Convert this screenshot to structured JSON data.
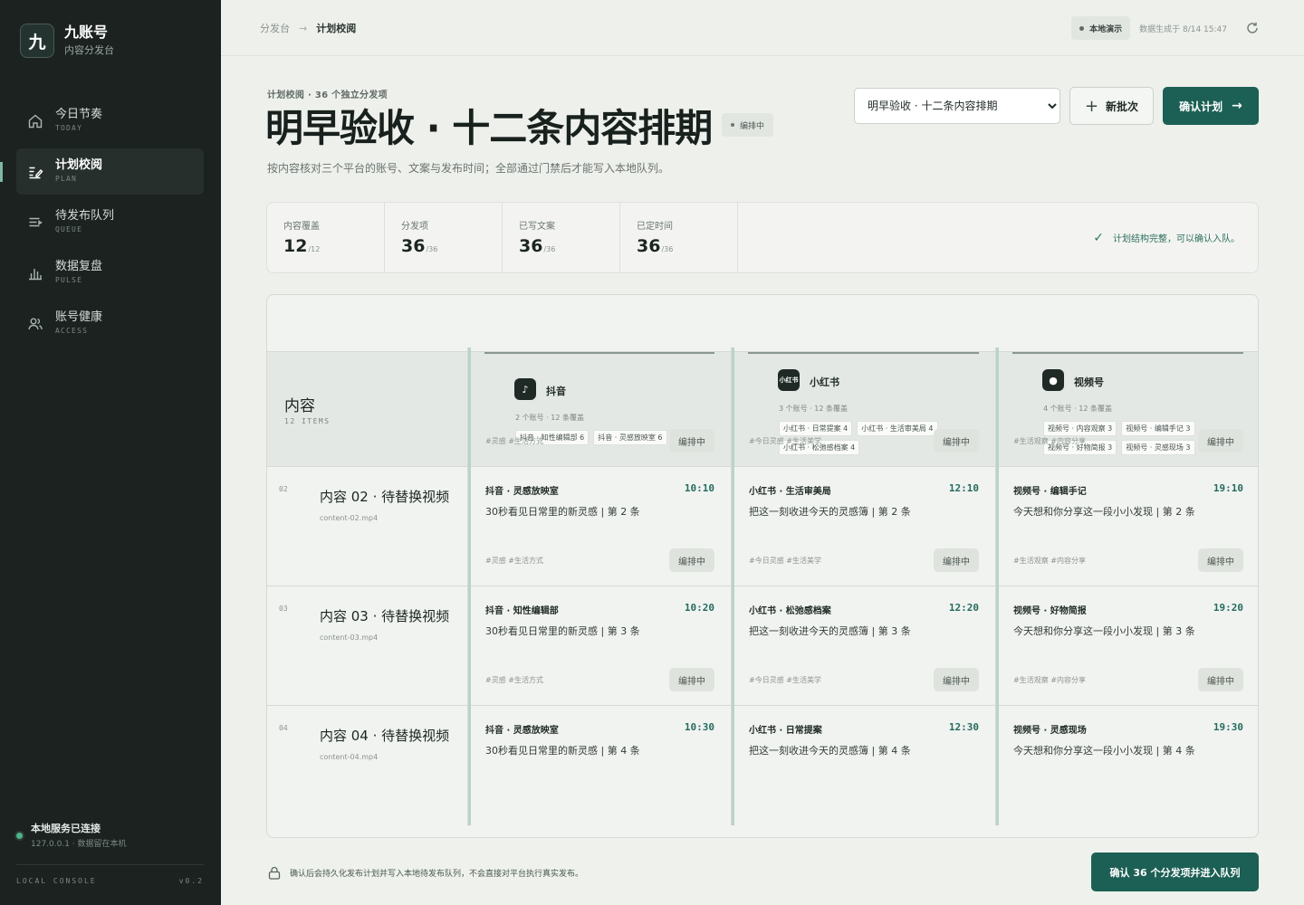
{
  "brand": {
    "logo_char": "九",
    "name": "九账号",
    "subtitle": "内容分发台"
  },
  "nav": {
    "items": [
      {
        "label": "今日节奏",
        "en": "TODAY",
        "icon": "home-icon",
        "active": false
      },
      {
        "label": "计划校阅",
        "en": "PLAN",
        "icon": "edit-list-icon",
        "active": true
      },
      {
        "label": "待发布队列",
        "en": "QUEUE",
        "icon": "queue-icon",
        "active": false
      },
      {
        "label": "数据复盘",
        "en": "PULSE",
        "icon": "bar-chart-icon",
        "active": false
      },
      {
        "label": "账号健康",
        "en": "ACCESS",
        "icon": "users-icon",
        "active": false
      }
    ]
  },
  "service": {
    "title": "本地服务已连接",
    "subtitle": "127.0.0.1 · 数据留在本机"
  },
  "footer": {
    "left": "LOCAL CONSOLE",
    "right": "v0.2"
  },
  "breadcrumb": {
    "root": "分发台",
    "current": "计划校阅"
  },
  "topbar": {
    "demo_label": "本地演示",
    "generated": "数据生成于 8/14 15:47"
  },
  "header": {
    "eyebrow": "计划校阅 · 36 个独立分发项",
    "title": "明早验收 · 十二条内容排期",
    "status": "编排中",
    "description": "按内容核对三个平台的账号、文案与发布时间；全部通过门禁后才能写入本地队列。",
    "select_value": "明早验收 · 十二条内容排期",
    "new_batch": "新批次",
    "confirm": "确认计划"
  },
  "stats": [
    {
      "label": "内容覆盖",
      "value": "12",
      "total": "/12"
    },
    {
      "label": "分发项",
      "value": "36",
      "total": "/36"
    },
    {
      "label": "已写文案",
      "value": "36",
      "total": "/36"
    },
    {
      "label": "已定时间",
      "value": "36",
      "total": "/36"
    }
  ],
  "stats_message": "计划结构完整，可以确认入队。",
  "board": {
    "content_header": "内容",
    "content_count": "12 ITEMS",
    "platforms": [
      {
        "name": "抖音",
        "icon": "douyin-icon",
        "logo": "♪",
        "meta": "2 个账号 · 12 条覆盖",
        "accounts": [
          "抖音 · 知性编辑部 6",
          "抖音 · 灵感放映室 6"
        ]
      },
      {
        "name": "小红书",
        "icon": "xiaohongshu-icon",
        "logo": "小红书",
        "meta": "3 个账号 · 12 条覆盖",
        "accounts": [
          "小红书 · 日常提案 4",
          "小红书 · 生活审美局 4",
          "小红书 · 松弛感档案 4"
        ]
      },
      {
        "name": "视频号",
        "icon": "wechat-channels-icon",
        "logo": "●",
        "meta": "4 个账号 · 12 条覆盖",
        "accounts": [
          "视频号 · 内容观察 3",
          "视频号 · 编辑手记 3",
          "视频号 · 好物简报 3",
          "视频号 · 灵感现场 3"
        ]
      }
    ],
    "rows": [
      {
        "num": "",
        "title": "",
        "file": "",
        "cells": [
          {
            "account": "",
            "time": "",
            "copy": "",
            "tags": "#灵感 #生活方式",
            "status": "编排中"
          },
          {
            "account": "",
            "time": "",
            "copy": "",
            "tags": "#今日灵感 #生活美学",
            "status": "编排中"
          },
          {
            "account": "",
            "time": "",
            "copy": "",
            "tags": "#生活观察 #内容分享",
            "status": "编排中"
          }
        ]
      },
      {
        "num": "02",
        "title": "内容 02 · 待替换视频",
        "file": "content-02.mp4",
        "cells": [
          {
            "account": "抖音 · 灵感放映室",
            "time": "10:10",
            "copy": "30秒看见日常里的新灵感 | 第 2 条",
            "tags": "#灵感 #生活方式",
            "status": "编排中"
          },
          {
            "account": "小红书 · 生活审美局",
            "time": "12:10",
            "copy": "把这一刻收进今天的灵感簿 | 第 2 条",
            "tags": "#今日灵感 #生活美学",
            "status": "编排中"
          },
          {
            "account": "视频号 · 编辑手记",
            "time": "19:10",
            "copy": "今天想和你分享这一段小小发现 | 第 2 条",
            "tags": "#生活观察 #内容分享",
            "status": "编排中"
          }
        ]
      },
      {
        "num": "03",
        "title": "内容 03 · 待替换视频",
        "file": "content-03.mp4",
        "cells": [
          {
            "account": "抖音 · 知性编辑部",
            "time": "10:20",
            "copy": "30秒看见日常里的新灵感 | 第 3 条",
            "tags": "#灵感 #生活方式",
            "status": "编排中"
          },
          {
            "account": "小红书 · 松弛感档案",
            "time": "12:20",
            "copy": "把这一刻收进今天的灵感簿 | 第 3 条",
            "tags": "#今日灵感 #生活美学",
            "status": "编排中"
          },
          {
            "account": "视频号 · 好物简报",
            "time": "19:20",
            "copy": "今天想和你分享这一段小小发现 | 第 3 条",
            "tags": "#生活观察 #内容分享",
            "status": "编排中"
          }
        ]
      },
      {
        "num": "04",
        "title": "内容 04 · 待替换视频",
        "file": "content-04.mp4",
        "cells": [
          {
            "account": "抖音 · 灵感放映室",
            "time": "10:30",
            "copy": "30秒看见日常里的新灵感 | 第 4 条",
            "tags": "",
            "status": ""
          },
          {
            "account": "小红书 · 日常提案",
            "time": "12:30",
            "copy": "把这一刻收进今天的灵感簿 | 第 4 条",
            "tags": "",
            "status": ""
          },
          {
            "account": "视频号 · 灵感现场",
            "time": "19:30",
            "copy": "今天想和你分享这一段小小发现 | 第 4 条",
            "tags": "",
            "status": ""
          }
        ]
      }
    ]
  },
  "bottom": {
    "note": "确认后会持久化发布计划并写入本地待发布队列，不会直接对平台执行真实发布。",
    "queue_button": "确认 36 个分发项并进入队列"
  },
  "colors": {
    "sidebar": "#1b2220",
    "accent": "#1c5f55",
    "time_text": "#256b5e",
    "background": "#eef0ec"
  }
}
